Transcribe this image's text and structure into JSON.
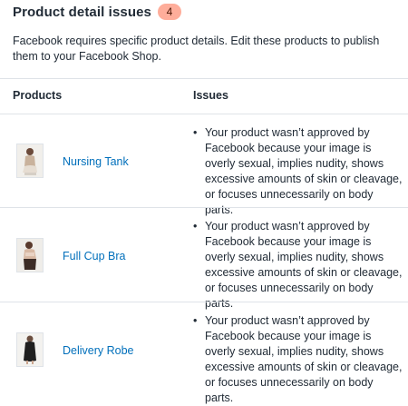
{
  "header": {
    "title": "Product detail issues",
    "count": "4"
  },
  "description": "Facebook requires specific product details. Edit these products to publish them to your Facebook Shop.",
  "table": {
    "columns": [
      "Products",
      "Issues"
    ],
    "rows": [
      {
        "product": "Nursing Tank",
        "issue": "Your product wasn’t approved by Facebook because your image is overly sexual, implies nudity, shows excessive amounts of skin or cleavage, or focuses unnecessarily on body parts."
      },
      {
        "product": "Full Cup Bra",
        "issue": "Your product wasn’t approved by Facebook because your image is overly sexual, implies nudity, shows excessive amounts of skin or cleavage, or focuses unnecessarily on body parts."
      },
      {
        "product": "Delivery Robe",
        "issue": "Your product wasn’t approved by Facebook because your image is overly sexual, implies nudity, shows excessive amounts of skin or cleavage, or focuses unnecessarily on body parts."
      }
    ]
  },
  "colors": {
    "badge_bg": "#fead9a",
    "link": "#006fbb",
    "divider": "#dfe3e8",
    "text": "#212b36"
  }
}
